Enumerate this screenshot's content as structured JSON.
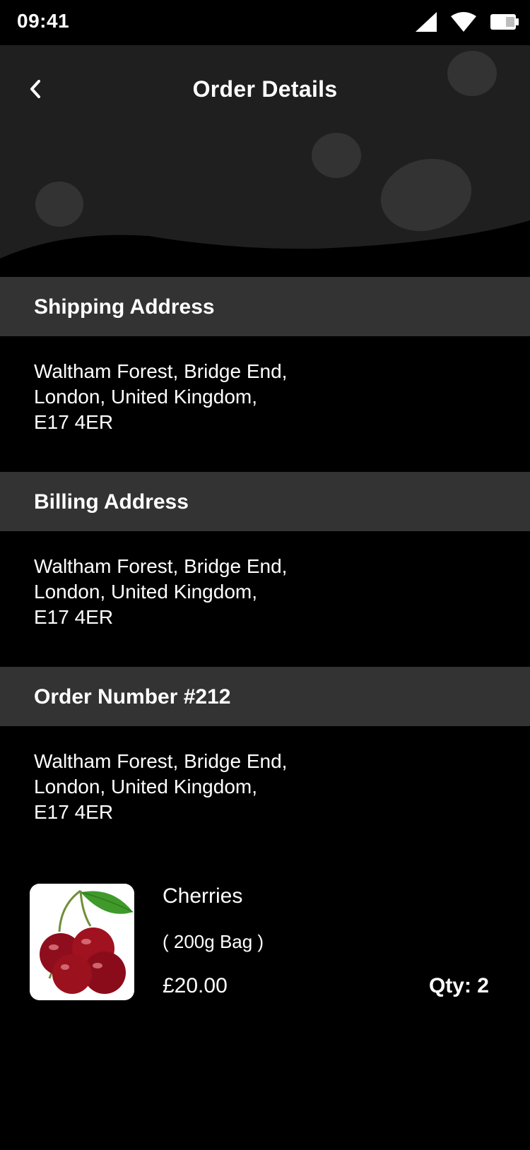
{
  "status_bar": {
    "time": "09:41",
    "icons": [
      "cellular-signal-icon",
      "wifi-icon",
      "battery-icon"
    ]
  },
  "header": {
    "title": "Order Details",
    "back_icon": "chevron-left-icon"
  },
  "shipping": {
    "title": "Shipping Address",
    "lines": [
      "Waltham Forest, Bridge End,",
      "London, United Kingdom,",
      "E17 4ER"
    ]
  },
  "billing": {
    "title": "Billing Address",
    "lines": [
      "Waltham Forest, Bridge End,",
      "London, United Kingdom,",
      "E17 4ER"
    ]
  },
  "order": {
    "title": "Order Number #212",
    "lines": [
      "Waltham Forest, Bridge End,",
      "London, United Kingdom,",
      "E17 4ER"
    ]
  },
  "product": {
    "name": "Cherries",
    "variant": "( 200g Bag )",
    "price": "£20.00",
    "qty": "Qty: 2",
    "image": "cherries-image"
  },
  "colors": {
    "background": "#000000",
    "header_bg": "#1f1f1f",
    "bubble": "#333333",
    "section_header": "#333333",
    "text": "#ffffff"
  }
}
